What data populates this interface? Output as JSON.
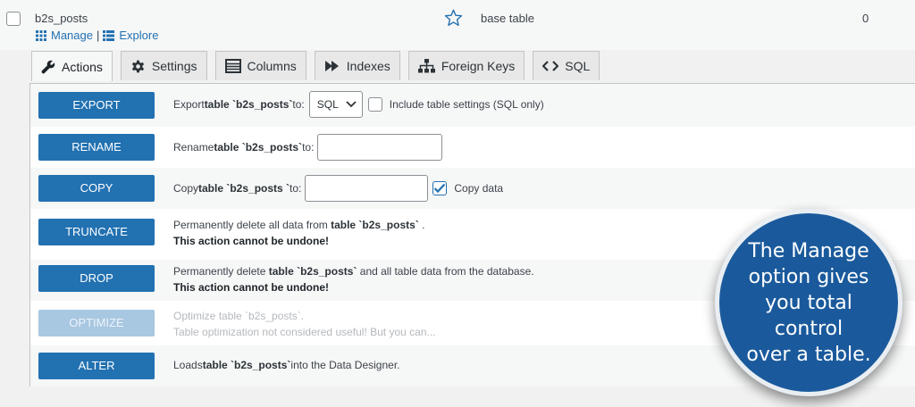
{
  "row": {
    "table_name": "b2s_posts",
    "manage_label": "Manage",
    "separator": "|",
    "explore_label": "Explore",
    "type": "base table",
    "count": "0"
  },
  "tabs": [
    {
      "label": "Actions",
      "icon": "wrench-icon",
      "active": true
    },
    {
      "label": "Settings",
      "icon": "gear-icon"
    },
    {
      "label": "Columns",
      "icon": "columns-icon"
    },
    {
      "label": "Indexes",
      "icon": "fast-forward-icon"
    },
    {
      "label": "Foreign Keys",
      "icon": "sitemap-icon"
    },
    {
      "label": "SQL",
      "icon": "code-icon"
    }
  ],
  "actions": {
    "export": {
      "button": "EXPORT",
      "prefix": "Export ",
      "table_word": "table `b2s_posts`",
      "suffix": " to:",
      "format_value": "SQL",
      "checkbox_label": "Include table settings (SQL only)"
    },
    "rename": {
      "button": "RENAME",
      "prefix": "Rename ",
      "table_word": "table `b2s_posts`",
      "suffix": " to:",
      "input_value": ""
    },
    "copy": {
      "button": "COPY",
      "prefix": "Copy ",
      "table_word": "table `b2s_posts `",
      "suffix": " to:",
      "input_value": "",
      "checkbox_label": "Copy data"
    },
    "truncate": {
      "button": "TRUNCATE",
      "prefix": "Permanently delete all data from ",
      "table_word": "table `b2s_posts`",
      "suffix": " .",
      "warning": "This action cannot be undone!"
    },
    "drop": {
      "button": "DROP",
      "prefix": "Permanently delete ",
      "table_word": "table `b2s_posts`",
      "suffix": " and all table data from the database.",
      "warning": "This action cannot be undone!"
    },
    "optimize": {
      "button": "OPTIMIZE",
      "prefix": "Optimize ",
      "table_word": "table `b2s_posts`",
      "suffix": ".",
      "note": "Table optimization not considered useful! But you can..."
    },
    "alter": {
      "button": "ALTER",
      "prefix": "Loads ",
      "table_word": "table `b2s_posts`",
      "suffix": " into the Data Designer."
    }
  },
  "callout": {
    "line1": "The Manage",
    "line2": "option gives",
    "line3": "you total control",
    "line4": "over a table."
  },
  "colors": {
    "accent": "#2271b1",
    "callout_bg": "#1a5a9c"
  }
}
